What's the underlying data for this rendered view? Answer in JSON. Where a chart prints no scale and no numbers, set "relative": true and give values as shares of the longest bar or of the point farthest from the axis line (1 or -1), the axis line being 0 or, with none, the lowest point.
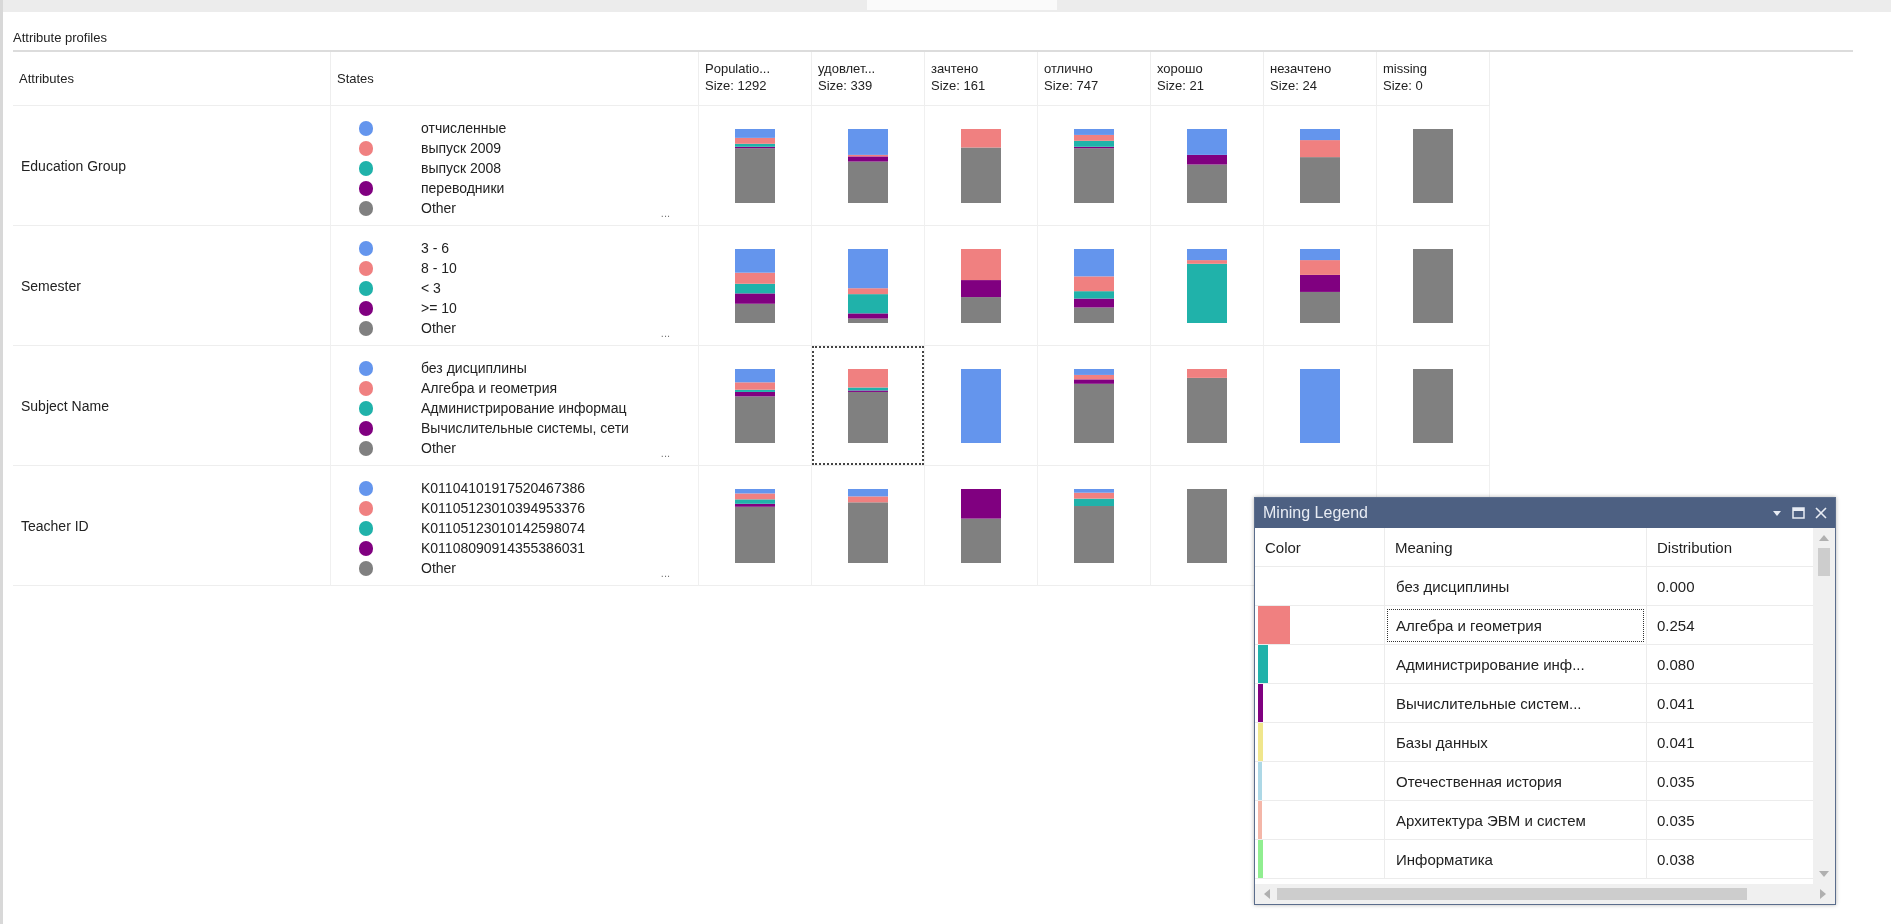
{
  "panel": {
    "title": "Attribute profiles"
  },
  "columns": [
    {
      "label": "Attributes"
    },
    {
      "label": "States"
    },
    {
      "label": "Populatio...",
      "size": "Size: 1292"
    },
    {
      "label": "удовлет...",
      "size": "Size: 339"
    },
    {
      "label": "зачтено",
      "size": "Size: 161"
    },
    {
      "label": "отлично",
      "size": "Size: 747"
    },
    {
      "label": "хорошо",
      "size": "Size: 21"
    },
    {
      "label": "незачтено",
      "size": "Size: 24"
    },
    {
      "label": "missing",
      "size": "Size: 0"
    }
  ],
  "rows": [
    {
      "attribute": "Education Group",
      "more": "...",
      "states": [
        {
          "label": "отчисленные",
          "color": "#6495ed"
        },
        {
          "label": "выпуск 2009",
          "color": "#f08080"
        },
        {
          "label": "выпуск 2008",
          "color": "#20b2aa"
        },
        {
          "label": "переводники",
          "color": "#800080"
        },
        {
          "label": "Other",
          "color": "#808080"
        }
      ],
      "cells": [
        {
          "selected": false
        },
        {
          "selected": false
        },
        {
          "selected": false
        },
        {
          "selected": false
        },
        {
          "selected": false
        },
        {
          "selected": false
        },
        {
          "selected": false
        }
      ],
      "chart_data": {
        "type": "bar",
        "stacked": true,
        "relative": true,
        "categories": [
          null,
          null,
          null,
          null,
          null,
          null,
          null
        ],
        "series": [
          {
            "color": "#808080",
            "values": [
              0.74,
              0.56,
              0.75,
              0.74,
              0.52,
              0.62,
              1
            ]
          },
          {
            "color": "#800080",
            "values": [
              0.02,
              0.07,
              0,
              0.02,
              0.13,
              0,
              0
            ]
          },
          {
            "color": "#20b2aa",
            "values": [
              0.04,
              0,
              0,
              0.08,
              0,
              0,
              0
            ]
          },
          {
            "color": "#f08080",
            "values": [
              0.08,
              0.02,
              0.25,
              0.08,
              0,
              0.23,
              0
            ]
          },
          {
            "color": "#6495ed",
            "values": [
              0.12,
              0.35,
              0,
              0.08,
              0.35,
              0.15,
              0
            ]
          }
        ]
      }
    },
    {
      "attribute": "Semester",
      "more": "...",
      "states": [
        {
          "label": "3 - 6",
          "color": "#6495ed"
        },
        {
          "label": "8 - 10",
          "color": "#f08080"
        },
        {
          "label": "< 3",
          "color": "#20b2aa"
        },
        {
          "label": ">= 10",
          "color": "#800080"
        },
        {
          "label": "Other",
          "color": "#808080"
        }
      ],
      "cells": [
        {
          "selected": false
        },
        {
          "selected": false
        },
        {
          "selected": false
        },
        {
          "selected": false
        },
        {
          "selected": false
        },
        {
          "selected": false
        },
        {
          "selected": false
        }
      ],
      "chart_data": {
        "type": "bar",
        "stacked": true,
        "relative": true,
        "categories": [
          null,
          null,
          null,
          null,
          null,
          null,
          null
        ],
        "series": [
          {
            "color": "#808080",
            "values": [
              0.26,
              0.06,
              0.35,
              0.21,
              0,
              0.42,
              1
            ]
          },
          {
            "color": "#800080",
            "values": [
              0.14,
              0.07,
              0.23,
              0.12,
              0,
              0.23,
              0
            ]
          },
          {
            "color": "#20b2aa",
            "values": [
              0.13,
              0.26,
              0,
              0.1,
              0.8,
              0,
              0
            ]
          },
          {
            "color": "#f08080",
            "values": [
              0.15,
              0.08,
              0.42,
              0.2,
              0.05,
              0.2,
              0
            ]
          },
          {
            "color": "#6495ed",
            "values": [
              0.32,
              0.53,
              0,
              0.37,
              0.15,
              0.15,
              0
            ]
          }
        ]
      }
    },
    {
      "attribute": "Subject Name",
      "more": "...",
      "states": [
        {
          "label": "без дисциплины",
          "color": "#6495ed"
        },
        {
          "label": "Алгебра и геометрия",
          "color": "#f08080"
        },
        {
          "label": "Администрирование информац",
          "color": "#20b2aa"
        },
        {
          "label": "Вычислительные системы, сети",
          "color": "#800080"
        },
        {
          "label": "Other",
          "color": "#808080"
        }
      ],
      "cells": [
        {
          "selected": false
        },
        {
          "selected": true
        },
        {
          "selected": false
        },
        {
          "selected": false
        },
        {
          "selected": false
        },
        {
          "selected": false
        },
        {
          "selected": false
        }
      ],
      "chart_data": {
        "type": "bar",
        "stacked": true,
        "relative": true,
        "categories": [
          null,
          null,
          null,
          null,
          null,
          null,
          null
        ],
        "series": [
          {
            "color": "#808080",
            "values": [
              0.63,
              0.69,
              0,
              0.8,
              0.88,
              0,
              1
            ]
          },
          {
            "color": "#800080",
            "values": [
              0.06,
              0.02,
              0,
              0.06,
              0,
              0,
              0
            ]
          },
          {
            "color": "#20b2aa",
            "values": [
              0.03,
              0.04,
              0,
              0,
              0,
              0,
              0
            ]
          },
          {
            "color": "#f08080",
            "values": [
              0.1,
              0.25,
              0,
              0.06,
              0.12,
              0,
              0
            ]
          },
          {
            "color": "#6495ed",
            "values": [
              0.18,
              0,
              1,
              0.08,
              0,
              1,
              0
            ]
          }
        ]
      }
    },
    {
      "attribute": "Teacher ID",
      "more": "...",
      "states": [
        {
          "label": "K01104101917520467386",
          "color": "#6495ed"
        },
        {
          "label": "K01105123010394953376",
          "color": "#f08080"
        },
        {
          "label": "K01105123010142598074",
          "color": "#20b2aa"
        },
        {
          "label": "K01108090914355386031",
          "color": "#800080"
        },
        {
          "label": "Other",
          "color": "#808080"
        }
      ],
      "cells": [
        {
          "selected": false
        },
        {
          "selected": false
        },
        {
          "selected": false
        },
        {
          "selected": false
        },
        {
          "selected": false
        }
      ],
      "chart_data": {
        "type": "bar",
        "stacked": true,
        "relative": true,
        "categories": [
          null,
          null,
          null,
          null,
          null
        ],
        "series": [
          {
            "color": "#808080",
            "values": [
              0.76,
              0.82,
              0.6,
              0.77,
              1
            ]
          },
          {
            "color": "#800080",
            "values": [
              0.04,
              0,
              0.4,
              0,
              0
            ]
          },
          {
            "color": "#20b2aa",
            "values": [
              0.06,
              0,
              0,
              0.1,
              0
            ]
          },
          {
            "color": "#f08080",
            "values": [
              0.08,
              0.08,
              0,
              0.08,
              0
            ]
          },
          {
            "color": "#6495ed",
            "values": [
              0.06,
              0.1,
              0,
              0.05,
              0
            ]
          }
        ]
      }
    }
  ],
  "legend": {
    "title": "Mining Legend",
    "columns": [
      "Color",
      "Meaning",
      "Distribution"
    ],
    "rows": [
      {
        "meaning": "без дисциплины",
        "distribution": "0.000",
        "selected": false
      },
      {
        "meaning": "Алгебра и геометрия",
        "distribution": "0.254",
        "level": 0.254,
        "color": "#f08080",
        "selected": true
      },
      {
        "meaning": "Администрирование инф...",
        "distribution": "0.080",
        "level": 0.08,
        "color": "#20b2aa",
        "selected": false
      },
      {
        "meaning": "Вычислительные систем...",
        "distribution": "0.041",
        "level": 0.041,
        "color": "#800080",
        "selected": false
      },
      {
        "meaning": "Базы данных",
        "distribution": "0.041",
        "level": 0.041,
        "color": "#f0e68c",
        "selected": false
      },
      {
        "meaning": "Отечественная история",
        "distribution": "0.035",
        "level": 0.035,
        "color": "#add8e6",
        "selected": false
      },
      {
        "meaning": "Архитектура ЭВМ и систем",
        "distribution": "0.035",
        "level": 0.035,
        "color": "#f4b6a8",
        "selected": false
      },
      {
        "meaning": "Информатика",
        "distribution": "0.038",
        "level": 0.038,
        "color": "#90ee90",
        "selected": false
      }
    ]
  }
}
